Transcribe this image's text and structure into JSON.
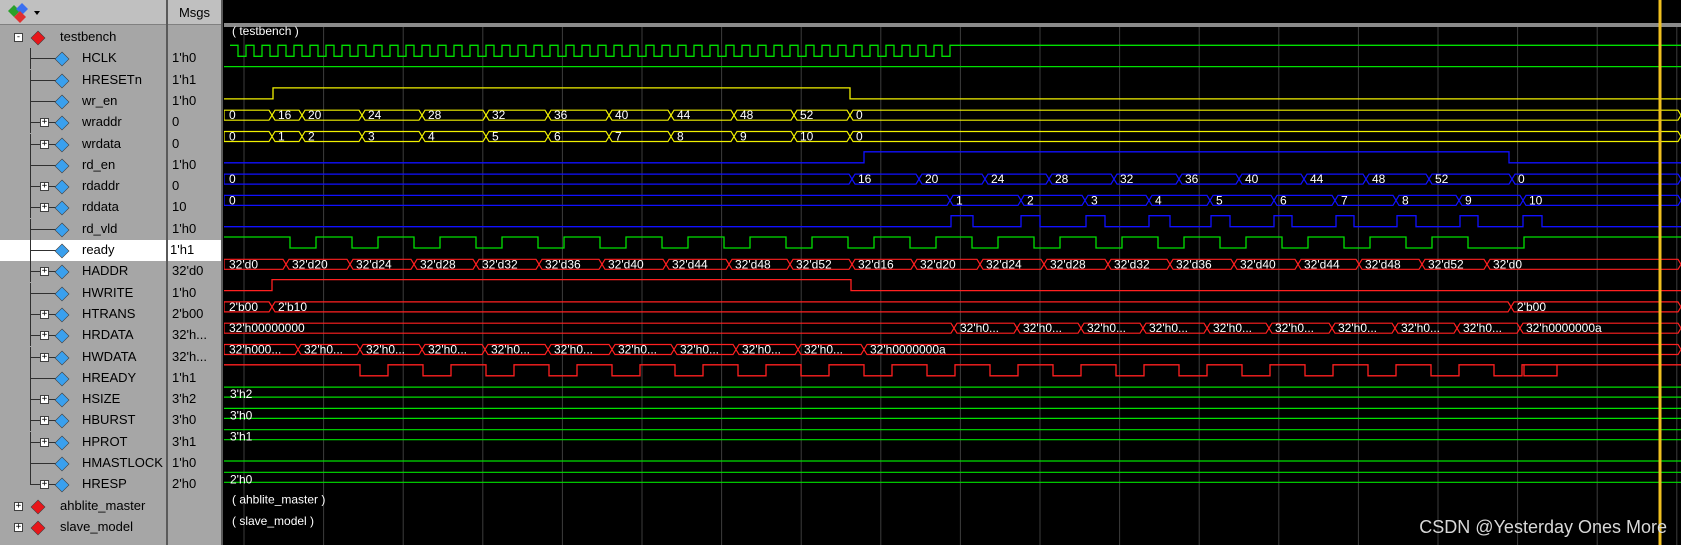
{
  "header": {
    "msgs_label": "Msgs",
    "toolbar_icon": "wave-group-icon"
  },
  "signals": [
    {
      "name": "testbench",
      "msg": "",
      "kind": "group",
      "level": 0,
      "expand": "-",
      "icon": "red-diamond"
    },
    {
      "name": "HCLK",
      "msg": "1'h0",
      "kind": "clk",
      "level": 1,
      "icon": "blue-diamond"
    },
    {
      "name": "HRESETn",
      "msg": "1'h1",
      "kind": "bit",
      "level": 1,
      "icon": "blue-diamond"
    },
    {
      "name": "wr_en",
      "msg": "1'h0",
      "kind": "bit",
      "level": 1,
      "icon": "blue-diamond"
    },
    {
      "name": "wraddr",
      "msg": "0",
      "kind": "bus",
      "level": 1,
      "expand": "+",
      "icon": "blue-diamond"
    },
    {
      "name": "wrdata",
      "msg": "0",
      "kind": "bus",
      "level": 1,
      "expand": "+",
      "icon": "blue-diamond"
    },
    {
      "name": "rd_en",
      "msg": "1'h0",
      "kind": "bit",
      "level": 1,
      "icon": "blue-diamond"
    },
    {
      "name": "rdaddr",
      "msg": "0",
      "kind": "bus",
      "level": 1,
      "expand": "+",
      "icon": "blue-diamond"
    },
    {
      "name": "rddata",
      "msg": "10",
      "kind": "bus",
      "level": 1,
      "expand": "+",
      "icon": "blue-diamond"
    },
    {
      "name": "rd_vld",
      "msg": "1'h0",
      "kind": "bit",
      "level": 1,
      "icon": "blue-diamond"
    },
    {
      "name": "ready",
      "msg": "1'h1",
      "kind": "bit",
      "level": 1,
      "icon": "blue-diamond",
      "selected": true
    },
    {
      "name": "HADDR",
      "msg": "32'd0",
      "kind": "bus",
      "level": 1,
      "expand": "+",
      "icon": "blue-diamond"
    },
    {
      "name": "HWRITE",
      "msg": "1'h0",
      "kind": "bit",
      "level": 1,
      "icon": "blue-diamond"
    },
    {
      "name": "HTRANS",
      "msg": "2'b00",
      "kind": "bus",
      "level": 1,
      "expand": "+",
      "icon": "blue-diamond"
    },
    {
      "name": "HRDATA",
      "msg": "32'h...",
      "kind": "bus",
      "level": 1,
      "expand": "+",
      "icon": "blue-diamond"
    },
    {
      "name": "HWDATA",
      "msg": "32'h...",
      "kind": "bus",
      "level": 1,
      "expand": "+",
      "icon": "blue-diamond"
    },
    {
      "name": "HREADY",
      "msg": "1'h1",
      "kind": "bit",
      "level": 1,
      "icon": "blue-diamond"
    },
    {
      "name": "HSIZE",
      "msg": "3'h2",
      "kind": "bus",
      "level": 1,
      "expand": "+",
      "icon": "blue-diamond"
    },
    {
      "name": "HBURST",
      "msg": "3'h0",
      "kind": "bus",
      "level": 1,
      "expand": "+",
      "icon": "blue-diamond"
    },
    {
      "name": "HPROT",
      "msg": "3'h1",
      "kind": "bus",
      "level": 1,
      "expand": "+",
      "icon": "blue-diamond"
    },
    {
      "name": "HMASTLOCK",
      "msg": "1'h0",
      "kind": "bit",
      "level": 1,
      "icon": "blue-diamond"
    },
    {
      "name": "HRESP",
      "msg": "2'h0",
      "kind": "bus",
      "level": 1,
      "expand": "+",
      "icon": "blue-diamond"
    },
    {
      "name": "ahblite_master",
      "msg": "",
      "kind": "group",
      "level": 0,
      "expand": "+",
      "icon": "red-diamond"
    },
    {
      "name": "slave_model",
      "msg": "",
      "kind": "group",
      "level": 0,
      "expand": "+",
      "icon": "red-diamond"
    }
  ],
  "wave_labels": {
    "testbench": "( testbench )",
    "ahblite_master": "( ahblite_master )",
    "slave_model": "( slave_model )",
    "wraddr": [
      "0",
      "16",
      "20",
      "24",
      "28",
      "32",
      "36",
      "40",
      "44",
      "48",
      "52",
      "0"
    ],
    "wrdata": [
      "0",
      "1",
      "2",
      "3",
      "4",
      "5",
      "6",
      "7",
      "8",
      "9",
      "10",
      "0"
    ],
    "rdaddr": [
      "0",
      "16",
      "20",
      "24",
      "28",
      "32",
      "36",
      "40",
      "44",
      "48",
      "52",
      "0"
    ],
    "rddata": [
      "0",
      "1",
      "2",
      "3",
      "4",
      "5",
      "6",
      "7",
      "8",
      "9",
      "10"
    ],
    "haddr": [
      "32'd0",
      "32'd20",
      "32'd24",
      "32'd28",
      "32'd32",
      "32'd36",
      "32'd40",
      "32'd44",
      "32'd48",
      "32'd52",
      "32'd16",
      "32'd20",
      "32'd24",
      "32'd28",
      "32'd32",
      "32'd36",
      "32'd40",
      "32'd44",
      "32'd48",
      "32'd52",
      "32'd0"
    ],
    "htrans": [
      "2'b00",
      "2'b10",
      "2'b00"
    ],
    "hrdata": [
      "32'h00000000",
      "32'h0...",
      "32'h0...",
      "32'h0...",
      "32'h0...",
      "32'h0...",
      "32'h0...",
      "32'h0...",
      "32'h0...",
      "32'h0...",
      "32'h0000000a"
    ],
    "hwdata": [
      "32'h000...",
      "32'h0...",
      "32'h0...",
      "32'h0...",
      "32'h0...",
      "32'h0...",
      "32'h0...",
      "32'h0...",
      "32'h0...",
      "32'h0...",
      "32'h0000000a"
    ],
    "hsize": "3'h2",
    "hburst": "3'h0",
    "hprot": "3'h1",
    "hresp": "2'h0"
  },
  "colors": {
    "green": "#00e000",
    "yellow": "#f0f000",
    "blue": "#1010ff",
    "red": "#ff2020",
    "cursor": "#f0c020",
    "grid": "#3c3c3c"
  },
  "watermark": "CSDN @Yesterday Ones More"
}
